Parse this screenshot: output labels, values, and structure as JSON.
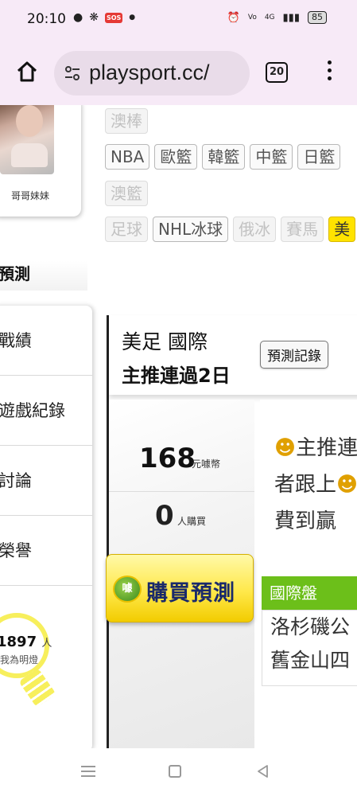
{
  "status_bar": {
    "time": "20:10",
    "left_icons": [
      "message-icon",
      "fan-icon",
      "sos-icon",
      "dot-icon"
    ],
    "sos_label": "SOS",
    "right_icons": [
      "alarm-icon",
      "volte-icon",
      "signal-icon"
    ],
    "network": "4G",
    "battery": "85"
  },
  "browser": {
    "url": "playsport.cc/",
    "tab_count": "20"
  },
  "profile": {
    "name": "哥哥妹妹"
  },
  "tags": {
    "row1": [
      {
        "label": "澳棒",
        "state": "dim"
      }
    ],
    "row2": [
      {
        "label": "NBA",
        "state": "normal"
      },
      {
        "label": "歐籃",
        "state": "normal"
      },
      {
        "label": "韓籃",
        "state": "normal"
      },
      {
        "label": "中籃",
        "state": "normal"
      },
      {
        "label": "日籃",
        "state": "normal"
      }
    ],
    "row3": [
      {
        "label": "澳籃",
        "state": "dim"
      }
    ],
    "row4": [
      {
        "label": "足球",
        "state": "dim"
      },
      {
        "label": "NHL冰球",
        "state": "normal"
      },
      {
        "label": "俄冰",
        "state": "dim"
      },
      {
        "label": "賽馬",
        "state": "dim"
      },
      {
        "label": "美",
        "state": "active"
      }
    ]
  },
  "section_title": "預測",
  "side_menu": {
    "items": [
      "戰績",
      "遊戲紀錄",
      "討論",
      "榮譽"
    ]
  },
  "light": {
    "count": "1897",
    "unit": "人",
    "label": "加我為明燈"
  },
  "prediction": {
    "league": "美足 國際",
    "streak": "主推連過2日",
    "record_button": "預測記錄",
    "price": "168",
    "price_unit": "元噱幣",
    "buyers": "0",
    "buyers_unit": "人購買",
    "buy_button": "購買預測",
    "coin_label": "噱",
    "promo_line1": "主推連",
    "promo_line2": "者跟上",
    "promo_line3": "費到贏",
    "market": "國際盤",
    "team1": "洛杉磯公",
    "team2": "舊金山四"
  },
  "colors": {
    "status_bg": "#f7eaf7",
    "active_tag": "#ffe300",
    "market_green": "#6cbf1a",
    "buy_yellow": "#ffe84a"
  }
}
